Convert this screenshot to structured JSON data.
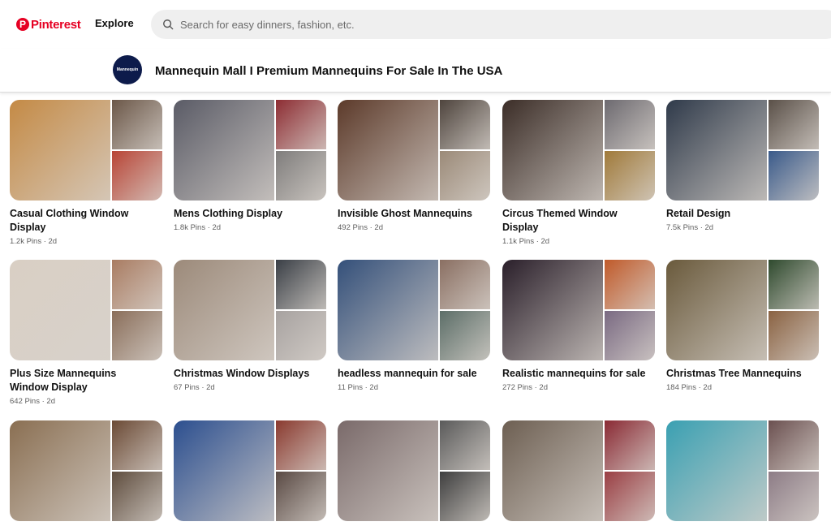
{
  "header": {
    "logo_text": "Pinterest",
    "logo_mark": "P",
    "explore_label": "Explore",
    "search_placeholder": "Search for easy dinners, fashion, etc."
  },
  "board": {
    "avatar_text": "Mannequin mall",
    "title": "Mannequin Mall I Premium Mannequins For Sale In The USA"
  },
  "boards": [
    {
      "title": "Casual Clothing Window Display",
      "meta": "1.2k Pins · 2d",
      "colors": [
        "#c48a45",
        "#6b5748",
        "#b84536"
      ]
    },
    {
      "title": "Mens Clothing Display",
      "meta": "1.8k Pins · 2d",
      "colors": [
        "#5a5b66",
        "#8d2d33",
        "#7f7d7c"
      ]
    },
    {
      "title": "Invisible Ghost Mannequins",
      "meta": "492 Pins · 2d",
      "colors": [
        "#5c3a2a",
        "#4e443d",
        "#9b8a78"
      ]
    },
    {
      "title": "Circus Themed Window Display",
      "meta": "1.1k Pins · 2d",
      "colors": [
        "#3b2d27",
        "#6d6a70",
        "#a07a3a"
      ]
    },
    {
      "title": "Retail Design",
      "meta": "7.5k Pins · 2d",
      "colors": [
        "#2f3a4a",
        "#5a5048",
        "#3a5a8a"
      ]
    },
    {
      "title": "Plus Size Mannequins Window Display",
      "meta": "642 Pins · 2d",
      "colors": [
        "#d9cfc4",
        "#a97c62",
        "#8a6e5a"
      ]
    },
    {
      "title": "Christmas Window Displays",
      "meta": "67 Pins · 2d",
      "colors": [
        "#9c8a7a",
        "#3a3f46",
        "#a7a2a0"
      ]
    },
    {
      "title": "headless mannequin for sale",
      "meta": "11 Pins · 2d",
      "colors": [
        "#34507a",
        "#8a6f62",
        "#5c6e68"
      ]
    },
    {
      "title": "Realistic mannequins for sale",
      "meta": "272 Pins · 2d",
      "colors": [
        "#2a1f2a",
        "#c05a2a",
        "#7a6a82"
      ]
    },
    {
      "title": "Christmas Tree Mannequins",
      "meta": "184 Pins · 2d",
      "colors": [
        "#6a5a3c",
        "#2f4a2e",
        "#8a6242"
      ]
    },
    {
      "title": "",
      "meta": "",
      "colors": [
        "#8a6f52",
        "#6b4a35",
        "#5f4d3e"
      ]
    },
    {
      "title": "",
      "meta": "",
      "colors": [
        "#2c4f8f",
        "#8a3a2f",
        "#5a4a44"
      ]
    },
    {
      "title": "",
      "meta": "",
      "colors": [
        "#7a6a6a",
        "#5a5a5a",
        "#3f3f3f"
      ]
    },
    {
      "title": "",
      "meta": "",
      "colors": [
        "#6d5f52",
        "#8a2a34",
        "#9a3f44"
      ]
    },
    {
      "title": "",
      "meta": "",
      "colors": [
        "#3aa0b2",
        "#6b5050",
        "#8d7c86"
      ]
    }
  ],
  "colors": {
    "brand": "#e60023",
    "search_bg": "#efefef"
  }
}
